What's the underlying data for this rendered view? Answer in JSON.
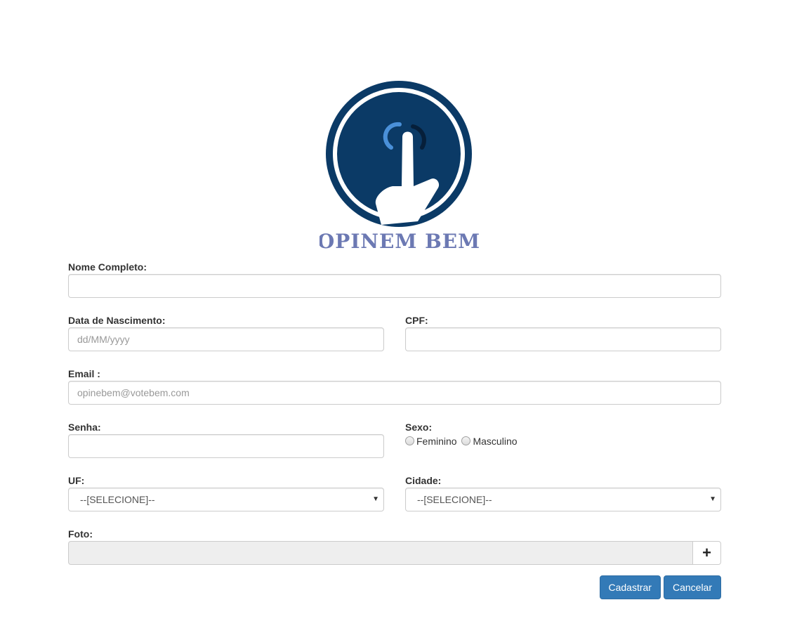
{
  "logo": {
    "text": "OPINEM BEM",
    "colors": {
      "circle": "#0b3a66",
      "text": "#6c79b3",
      "accent": "#4a90d9"
    }
  },
  "form": {
    "nome": {
      "label": "Nome Completo:",
      "value": "",
      "placeholder": ""
    },
    "nascimento": {
      "label": "Data de Nascimento:",
      "value": "",
      "placeholder": "dd/MM/yyyy"
    },
    "cpf": {
      "label": "CPF:",
      "value": "",
      "placeholder": ""
    },
    "email": {
      "label": "Email :",
      "value": "",
      "placeholder": "opinebem@votebem.com"
    },
    "senha": {
      "label": "Senha:",
      "value": "",
      "placeholder": ""
    },
    "sexo": {
      "label": "Sexo:",
      "options": [
        "Feminino",
        "Masculino"
      ]
    },
    "uf": {
      "label": "UF:",
      "selected": "--[SELECIONE]--"
    },
    "cidade": {
      "label": "Cidade:",
      "selected": "--[SELECIONE]--"
    },
    "foto": {
      "label": "Foto:",
      "button": "+"
    }
  },
  "actions": {
    "submit_label": "Cadastrar",
    "cancel_label": "Cancelar"
  },
  "colors": {
    "primary": "#337ab7",
    "border": "#cccccc"
  }
}
